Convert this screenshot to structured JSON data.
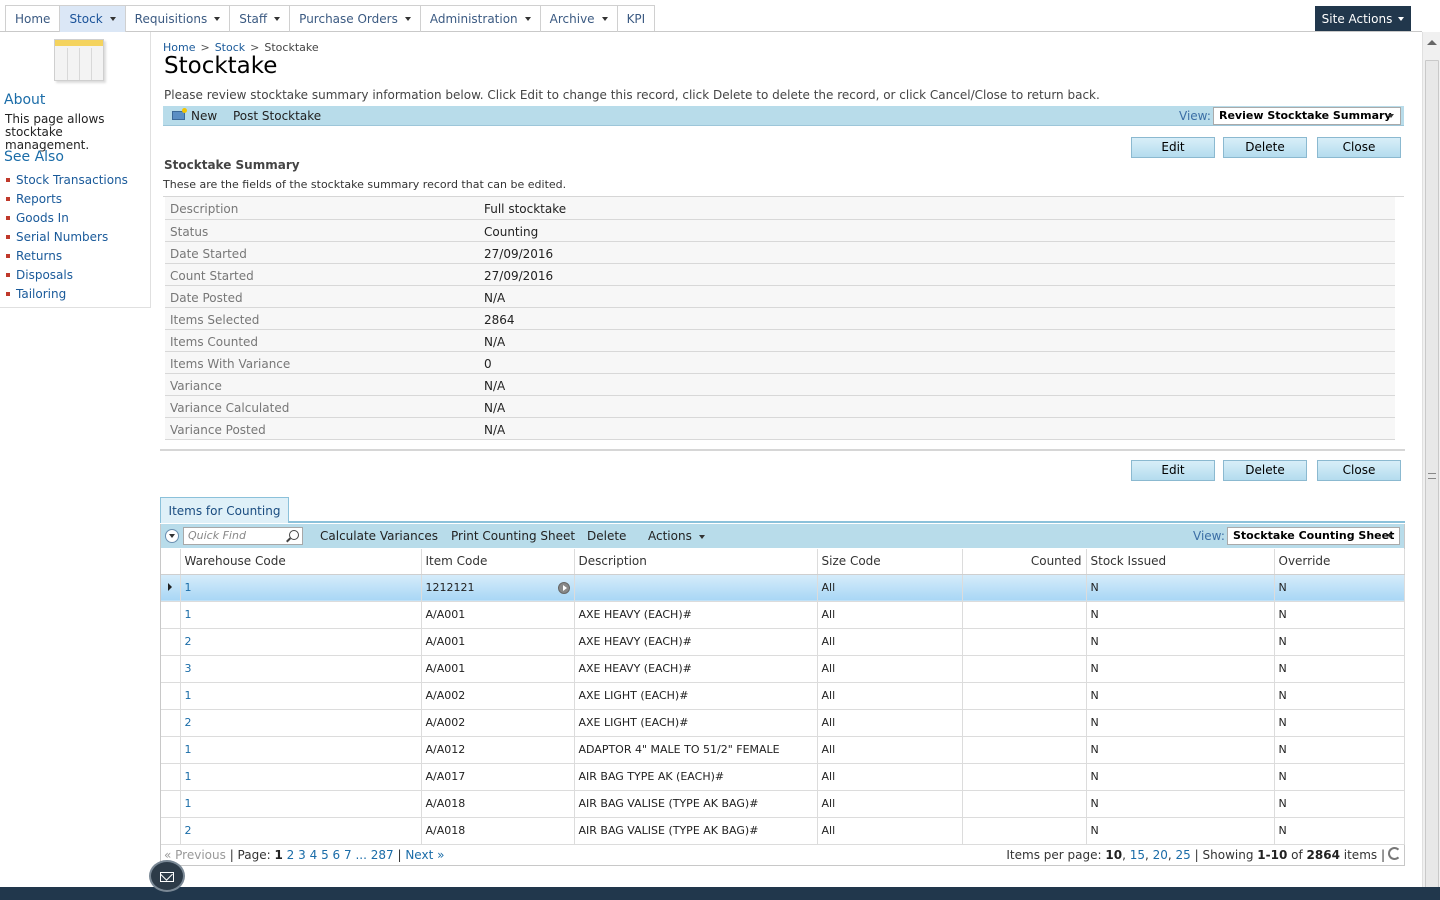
{
  "nav": {
    "tabs": [
      {
        "label": "Home",
        "dropdown": false
      },
      {
        "label": "Stock",
        "dropdown": true,
        "active": true
      },
      {
        "label": "Requisitions",
        "dropdown": true
      },
      {
        "label": "Staff",
        "dropdown": true
      },
      {
        "label": "Purchase Orders",
        "dropdown": true
      },
      {
        "label": "Administration",
        "dropdown": true
      },
      {
        "label": "Archive",
        "dropdown": true
      },
      {
        "label": "KPI",
        "dropdown": false
      }
    ],
    "site_actions": "Site Actions"
  },
  "sidebar": {
    "about_heading": "About",
    "about_text": "This page allows stocktake management.",
    "see_also_heading": "See Also",
    "links": [
      "Stock Transactions",
      "Reports",
      "Goods In",
      "Serial Numbers",
      "Returns",
      "Disposals",
      "Tailoring"
    ]
  },
  "breadcrumb": {
    "home": "Home",
    "stock": "Stock",
    "current": "Stocktake",
    "sep": ">"
  },
  "page": {
    "title": "Stocktake",
    "instructions": "Please review stocktake summary information below. Click Edit to change this record, click Delete to delete the record, or click Cancel/Close to return back."
  },
  "toolbar": {
    "new": "New",
    "post": "Post Stocktake",
    "view_label": "View:",
    "view_value": "Review Stocktake Summary"
  },
  "buttons": {
    "edit": "Edit",
    "delete": "Delete",
    "close": "Close"
  },
  "summary": {
    "title": "Stocktake Summary",
    "subtitle": "These are the fields of the stocktake summary record that can be edited.",
    "fields": [
      {
        "label": "Description",
        "value": "Full stocktake"
      },
      {
        "label": "Status",
        "value": "Counting"
      },
      {
        "label": "Date Started",
        "value": "27/09/2016"
      },
      {
        "label": "Count Started",
        "value": "27/09/2016"
      },
      {
        "label": "Date Posted",
        "value": "N/A"
      },
      {
        "label": "Items Selected",
        "value": "2864"
      },
      {
        "label": "Items Counted",
        "value": "N/A"
      },
      {
        "label": "Items With Variance",
        "value": "0"
      },
      {
        "label": "Variance",
        "value": "N/A"
      },
      {
        "label": "Variance Calculated",
        "value": "N/A"
      },
      {
        "label": "Variance Posted",
        "value": "N/A"
      }
    ]
  },
  "items": {
    "tab": "Items for Counting",
    "quick_find_placeholder": "Quick Find",
    "actions": [
      "Calculate Variances",
      "Print Counting Sheet",
      "Delete",
      "Actions"
    ],
    "view_label": "View:",
    "view_value": "Stocktake Counting Sheet",
    "columns": [
      "Warehouse Code",
      "Item Code",
      "Description",
      "Size Code",
      "Counted",
      "Stock Issued",
      "Override"
    ],
    "rows": [
      {
        "warehouse": "1",
        "item": "1212121",
        "desc": "",
        "size": "All",
        "counted": "",
        "issued": "N",
        "override": "N",
        "selected": true
      },
      {
        "warehouse": "1",
        "item": "A/A001",
        "desc": "AXE HEAVY (EACH)#",
        "size": "All",
        "counted": "",
        "issued": "N",
        "override": "N"
      },
      {
        "warehouse": "2",
        "item": "A/A001",
        "desc": "AXE HEAVY (EACH)#",
        "size": "All",
        "counted": "",
        "issued": "N",
        "override": "N"
      },
      {
        "warehouse": "3",
        "item": "A/A001",
        "desc": "AXE HEAVY (EACH)#",
        "size": "All",
        "counted": "",
        "issued": "N",
        "override": "N"
      },
      {
        "warehouse": "1",
        "item": "A/A002",
        "desc": "AXE LIGHT (EACH)#",
        "size": "All",
        "counted": "",
        "issued": "N",
        "override": "N"
      },
      {
        "warehouse": "2",
        "item": "A/A002",
        "desc": "AXE LIGHT (EACH)#",
        "size": "All",
        "counted": "",
        "issued": "N",
        "override": "N"
      },
      {
        "warehouse": "1",
        "item": "A/A012",
        "desc": "ADAPTOR 4\" MALE TO 51/2\" FEMALE",
        "size": "All",
        "counted": "",
        "issued": "N",
        "override": "N"
      },
      {
        "warehouse": "1",
        "item": "A/A017",
        "desc": "AIR BAG TYPE AK (EACH)#",
        "size": "All",
        "counted": "",
        "issued": "N",
        "override": "N"
      },
      {
        "warehouse": "1",
        "item": "A/A018",
        "desc": "AIR BAG VALISE (TYPE AK BAG)#",
        "size": "All",
        "counted": "",
        "issued": "N",
        "override": "N"
      },
      {
        "warehouse": "2",
        "item": "A/A018",
        "desc": "AIR BAG VALISE (TYPE AK BAG)#",
        "size": "All",
        "counted": "",
        "issued": "N",
        "override": "N"
      }
    ]
  },
  "pager": {
    "previous": "« Previous",
    "page_label": "Page:",
    "pages": [
      "1",
      "2",
      "3",
      "4",
      "5",
      "6",
      "7"
    ],
    "current_page": "1",
    "ellipsis": "...",
    "last_page": "287",
    "next": "Next »",
    "items_per_page_label": "Items per page:",
    "per_page_options": [
      "10",
      "15",
      "20",
      "25"
    ],
    "current_per_page": "10",
    "showing_label": "Showing",
    "range": "1-10",
    "of_label": "of",
    "total": "2864",
    "items_label": "items"
  },
  "colors": {
    "toolbar_bg": "#b8dcea",
    "link": "#1a6ca8",
    "site_actions_bg": "#21374c",
    "selected_row": "#a8d6f5"
  }
}
